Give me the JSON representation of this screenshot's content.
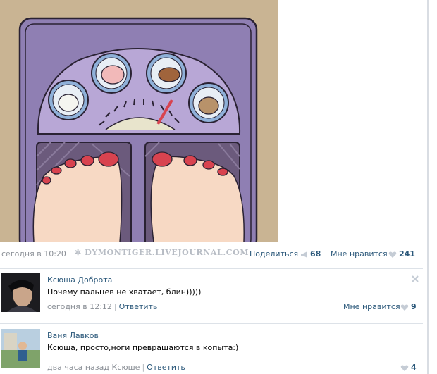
{
  "post": {
    "date": "сегодня в 10:20",
    "watermark": "DYMONTIGER.LIVEJOURNAL.COM",
    "share_label": "Поделиться",
    "share_count": "68",
    "like_label": "Мне нравится",
    "like_count": "241"
  },
  "comments": [
    {
      "author": "Ксюша Доброта",
      "text": "Почему пальцев не хватает, блин)))))",
      "date": "сегодня в 12:12",
      "reply_to": "",
      "reply_label": "Ответить",
      "like_label": "Мне нравится",
      "like_count": "9"
    },
    {
      "author": "Ваня Лавков",
      "text": "Ксюша, просто,ноги превращаются в копыта:)",
      "date": "два часа назад",
      "reply_to": "Ксюше",
      "reply_label": "Ответить",
      "like_label": "",
      "like_count": "4"
    }
  ],
  "colors": {
    "link": "#2b587a",
    "muted": "#8a8f96",
    "scale_body": "#8f7fb3",
    "scale_inner": "#b8a7d6",
    "toenail": "#d8434f"
  },
  "icons": {
    "share": "megaphone-icon",
    "like": "heart-icon",
    "close": "close-icon",
    "watermark": "tiger-paw-icon"
  }
}
